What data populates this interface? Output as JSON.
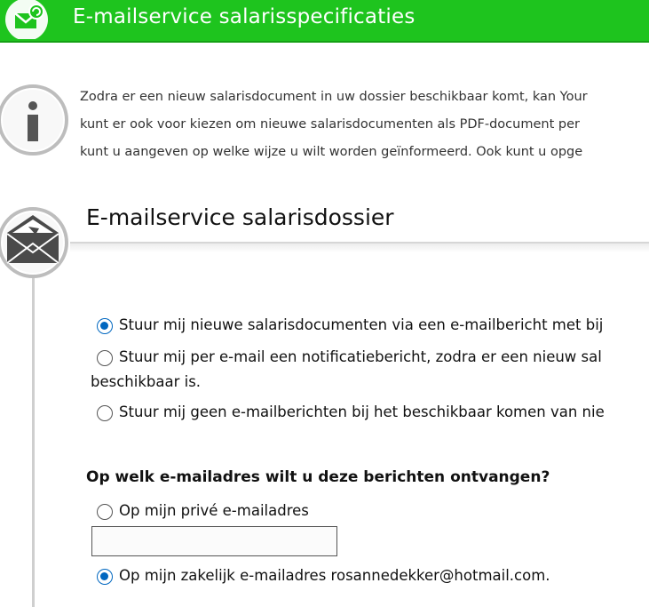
{
  "header": {
    "title": "E-mailservice salarisspecificaties",
    "bg_color": "#1ec41e",
    "logo_icon": "envelope-refresh-icon"
  },
  "info": {
    "icon": "info-icon",
    "lines": [
      "Zodra er een nieuw salarisdocument in uw dossier beschikbaar komt, kan Your",
      "kunt er ook voor kiezen om nieuwe salarisdocumenten als PDF-document per",
      "kunt u aangeven op welke wijze u wilt worden geïnformeerd. Ook kunt u opge"
    ]
  },
  "section": {
    "icon": "envelope-icon",
    "title": "E-mailservice salarisdossier"
  },
  "options": {
    "opt1": {
      "label": "Stuur mij nieuwe salarisdocumenten via een e-mailbericht met bij",
      "checked": true
    },
    "opt2": {
      "label_line1": "Stuur mij per e-mail een notificatiebericht, zodra er een nieuw sal",
      "label_line2": "beschikbaar is.",
      "checked": false
    },
    "opt3": {
      "label": "Stuur mij geen e-mailberichten bij het beschikbaar komen van nie",
      "checked": false
    }
  },
  "email_question": {
    "title": "Op welk e-mailadres wilt u deze berichten ontvangen?",
    "private": {
      "label": "Op mijn privé e-mailadres",
      "checked": false,
      "value": ""
    },
    "business": {
      "label": "Op mijn zakelijk e-mailadres rosannedekker@hotmail.com.",
      "checked": true
    }
  },
  "colors": {
    "radio_selected": "#0067c0",
    "accent": "#1ec41e"
  }
}
